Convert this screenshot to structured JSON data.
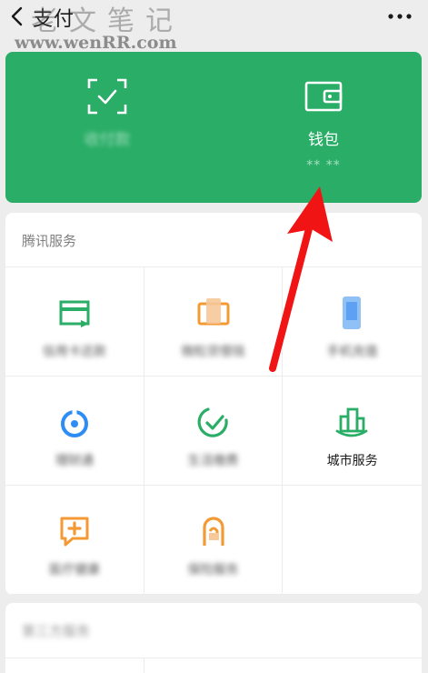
{
  "header": {
    "title": "支付",
    "watermark_title": "老文笔记",
    "watermark_url": "www.wenRR.com"
  },
  "wallet_card": {
    "scan_label": "收付款",
    "wallet_label": "钱包",
    "wallet_balance": "** **"
  },
  "services": {
    "title": "腾讯服务",
    "items": [
      {
        "label": "信用卡还款",
        "icon": "card-repay-icon",
        "color": "#2aae67",
        "blurred": true
      },
      {
        "label": "微粒贷借钱",
        "icon": "loan-icon",
        "color": "#f39a34",
        "blurred": true
      },
      {
        "label": "手机充值",
        "icon": "phone-topup-icon",
        "color": "#3d8cf0",
        "blurred": true
      },
      {
        "label": "理财通",
        "icon": "wealth-icon",
        "color": "#2e8df5",
        "blurred": true
      },
      {
        "label": "生活缴费",
        "icon": "utility-bill-icon",
        "color": "#2aae67",
        "blurred": true
      },
      {
        "label": "城市服务",
        "icon": "city-service-icon",
        "color": "#2aae67",
        "blurred": false
      },
      {
        "label": "医疗健康",
        "icon": "medical-icon",
        "color": "#f39a34",
        "blurred": true
      },
      {
        "label": "保险服务",
        "icon": "insurance-icon",
        "color": "#f39a34",
        "blurred": true
      }
    ]
  },
  "promo": {
    "title": "第三方服务"
  },
  "colors": {
    "brand_green": "#2aae67",
    "background": "#ededed",
    "annotation_red": "#f01414"
  }
}
